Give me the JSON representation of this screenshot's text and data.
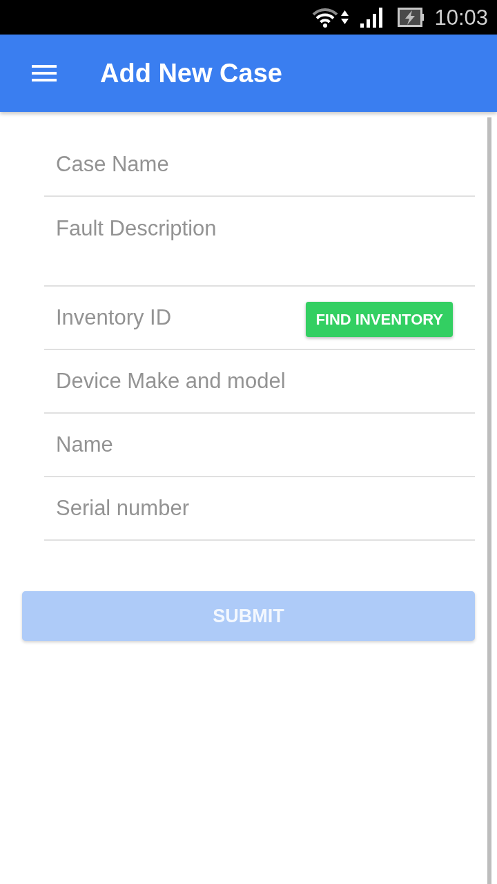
{
  "status_bar": {
    "time": "10:03"
  },
  "app_bar": {
    "title": "Add New Case"
  },
  "fields": [
    {
      "kind": "text",
      "placeholder": "Case Name"
    },
    {
      "kind": "multiline",
      "placeholder": "Fault Description"
    },
    {
      "kind": "text",
      "placeholder": "Inventory ID",
      "button": {
        "label": "FIND INVENTORY"
      }
    },
    {
      "kind": "text",
      "placeholder": "Device Make and model"
    },
    {
      "kind": "text",
      "placeholder": "Name"
    },
    {
      "kind": "text",
      "placeholder": "Serial number"
    }
  ],
  "submit": {
    "label": "SUBMIT",
    "disabled": true
  }
}
